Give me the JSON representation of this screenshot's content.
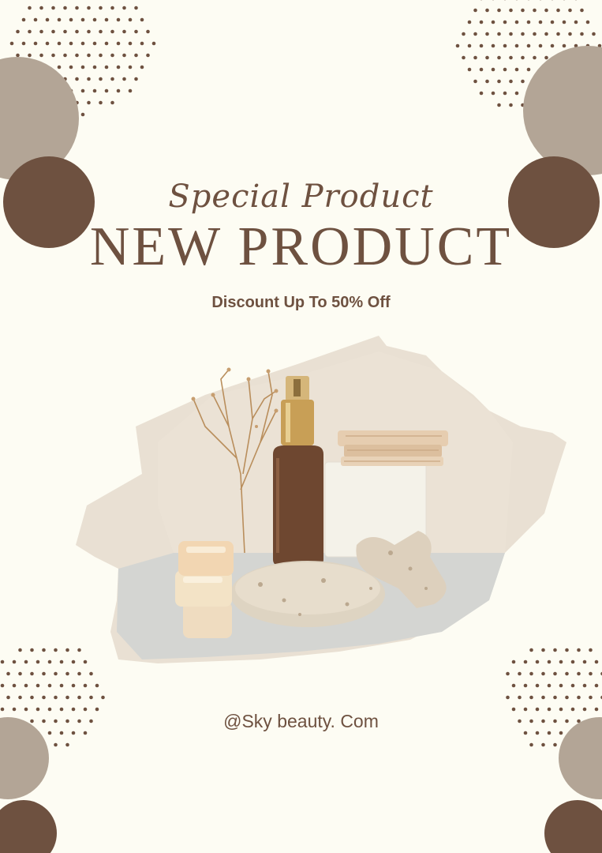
{
  "poster": {
    "script_title": "Special Product",
    "main_title": "NEW PRODUCT",
    "subtitle": "Discount Up To 50% Off",
    "handle": "@Sky beauty. Com"
  },
  "colors": {
    "background": "#fdfcf3",
    "dark_brown": "#6e5140",
    "taupe": "#b3a596",
    "brush": "#e7ddd0"
  },
  "icons": [
    "dot-pattern-icon",
    "circle-blob-icon",
    "serum-bottle-icon",
    "jar-icon",
    "stone-icon",
    "dried-flower-icon"
  ]
}
